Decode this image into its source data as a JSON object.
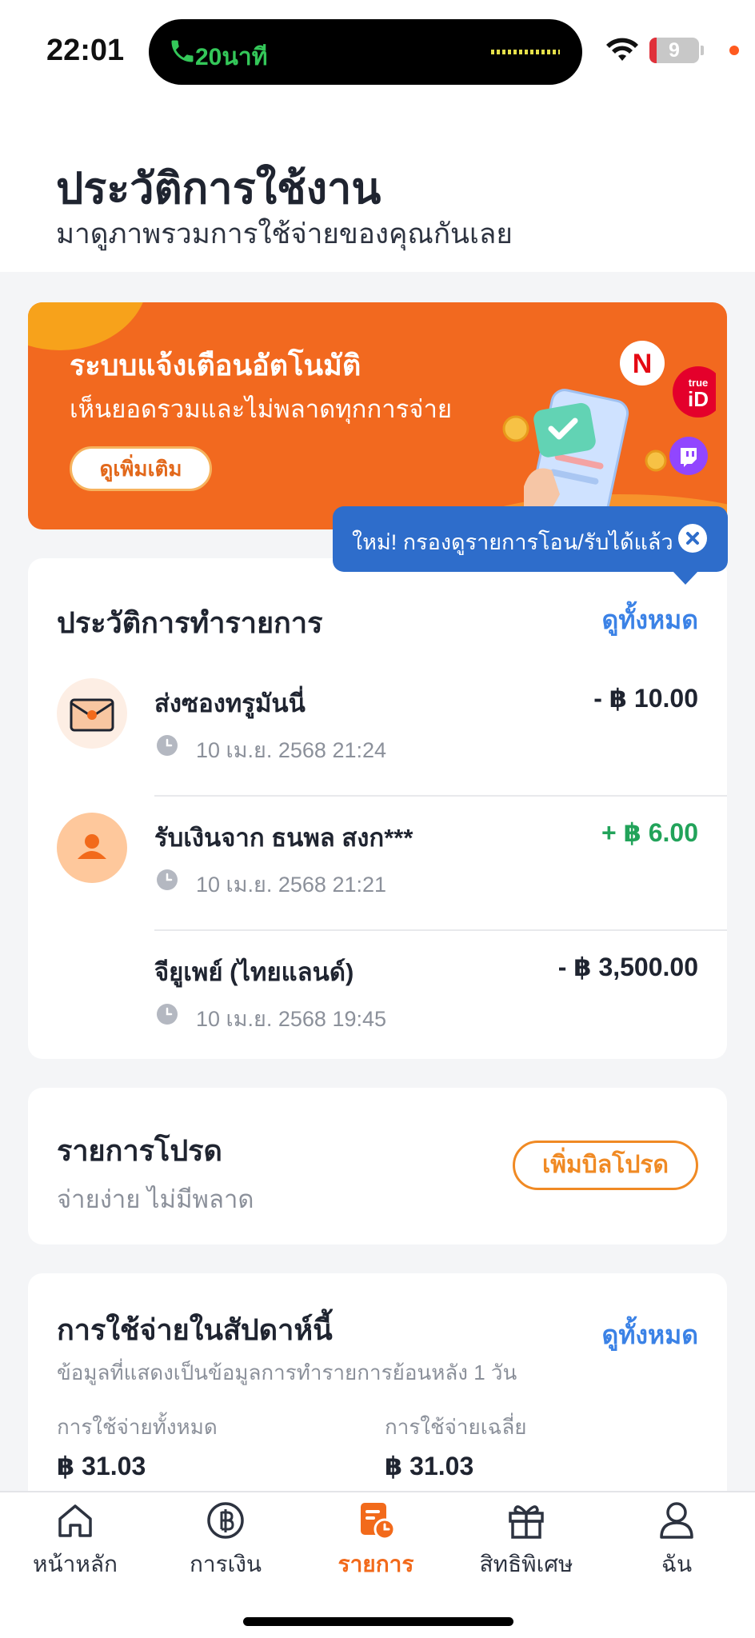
{
  "status_bar": {
    "time": "22:01",
    "call_label": "20นาที",
    "battery_level": "9",
    "icons": [
      "phone-icon",
      "wifi-icon",
      "battery-icon"
    ]
  },
  "header": {
    "title": "ประวัติการใช้งาน",
    "subtitle": "มาดูภาพรวมการใช้จ่ายของคุณกันเลย"
  },
  "banner": {
    "title": "ระบบแจ้งเตือนอัตโนมัติ",
    "subtitle": "เห็นยอดรวมและไม่พลาดทุกการจ่าย",
    "button_label": "ดูเพิ่มเติม",
    "logo_netflix": "N",
    "logo_trueid_top": "true",
    "logo_trueid_bottom": "iD"
  },
  "tooltip": {
    "text": "ใหม่! กรองดูรายการโอน/รับได้แล้ว"
  },
  "transactions": {
    "title": "ประวัติการทำรายการ",
    "view_all": "ดูทั้งหมด",
    "items": [
      {
        "name": "ส่งซองทรูมันนี่",
        "time": "10 เม.ย. 2568 21:24",
        "amount": "- ฿ 10.00",
        "type": "debit",
        "icon": "envelope-icon"
      },
      {
        "name": "รับเงินจาก ธนพล สงก***",
        "time": "10 เม.ย. 2568 21:21",
        "amount": "+ ฿ 6.00",
        "type": "credit",
        "icon": "person-icon"
      },
      {
        "name": "จียูเพย์ (ไทยแลนด์)",
        "time": "10 เม.ย. 2568 19:45",
        "amount": "- ฿ 3,500.00",
        "type": "debit",
        "icon": ""
      }
    ]
  },
  "favorites": {
    "title": "รายการโปรด",
    "subtitle": "จ่ายง่าย ไม่มีพลาด",
    "button_label": "เพิ่มบิลโปรด"
  },
  "weekly_spending": {
    "title": "การใช้จ่ายในสัปดาห์นี้",
    "view_all": "ดูทั้งหมด",
    "subtitle": "ข้อมูลที่แสดงเป็นข้อมูลการทำรายการย้อนหลัง 1 วัน",
    "total_label": "การใช้จ่ายทั้งหมด",
    "total_value": "฿ 31.03",
    "average_label": "การใช้จ่ายเฉลี่ย",
    "average_value": "฿ 31.03"
  },
  "tab_bar": {
    "tabs": [
      {
        "label": "หน้าหลัก",
        "icon": "home-icon",
        "active": false
      },
      {
        "label": "การเงิน",
        "icon": "baht-coin-icon",
        "active": false
      },
      {
        "label": "รายการ",
        "icon": "history-list-icon",
        "active": true
      },
      {
        "label": "สิทธิพิเศษ",
        "icon": "gift-icon",
        "active": false
      },
      {
        "label": "ฉัน",
        "icon": "profile-icon",
        "active": false
      }
    ]
  },
  "colors": {
    "brand_orange": "#f26a1b",
    "link_blue": "#3b82e6",
    "credit_green": "#22a35a",
    "tooltip_blue": "#2e6dcb"
  }
}
